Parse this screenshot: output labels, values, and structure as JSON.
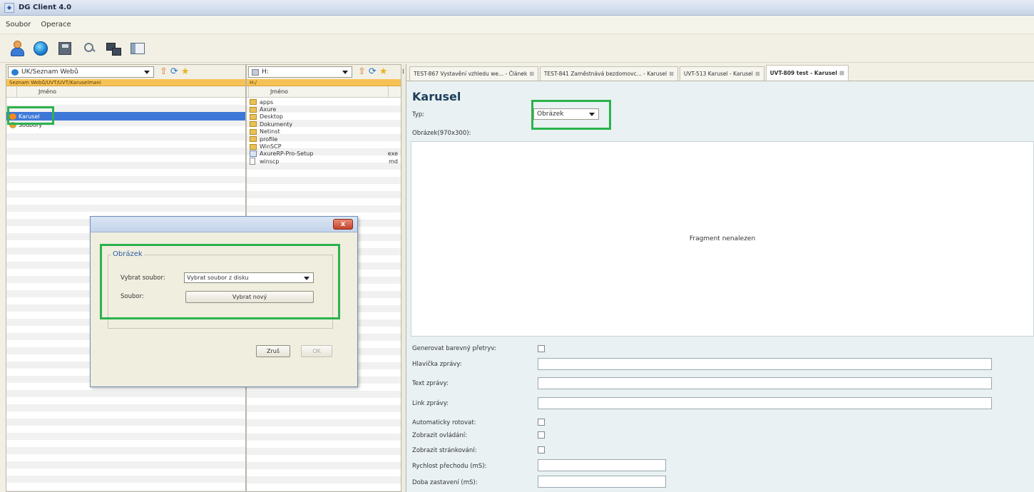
{
  "window": {
    "title": "DG Client 4.0"
  },
  "menu": {
    "items": [
      "Soubor",
      "Operace"
    ]
  },
  "toolbar": {
    "icons": [
      "user-icon",
      "globe-icon",
      "save-icon",
      "search-icon",
      "network-icon",
      "panel-icon"
    ]
  },
  "left_pane": {
    "combo_value": "UK/Seznam Webů",
    "path": "Seznam Webů/UVT/UVT/Karuselmani",
    "column_name": "Jméno",
    "tree": [
      {
        "label": "Karusel",
        "selected": true
      },
      {
        "label": "Soubory",
        "selected": false
      }
    ]
  },
  "mid_pane": {
    "combo_value": "H:",
    "path": "H:/",
    "column_name": "Jméno",
    "files": [
      {
        "name": "apps",
        "type": "folder",
        "ext": ""
      },
      {
        "name": "Axure",
        "type": "folder",
        "ext": ""
      },
      {
        "name": "Desktop",
        "type": "folder",
        "ext": ""
      },
      {
        "name": "Dokumenty",
        "type": "folder",
        "ext": ""
      },
      {
        "name": "Netinst",
        "type": "folder",
        "ext": ""
      },
      {
        "name": "profile",
        "type": "folder",
        "ext": ""
      },
      {
        "name": "WinSCP",
        "type": "folder",
        "ext": ""
      },
      {
        "name": "AxureRP-Pro-Setup",
        "type": "exe",
        "ext": "exe"
      },
      {
        "name": "winscp",
        "type": "doc",
        "ext": "md"
      }
    ]
  },
  "tabs": [
    {
      "label": "TEST-867 Vystavění vzhledu we... - Článek",
      "active": false
    },
    {
      "label": "TEST-841 Zaměstnává bezdomovc... - Karusel",
      "active": false
    },
    {
      "label": "UVT-513 Karusel - Karusel",
      "active": false
    },
    {
      "label": "UVT-809 test - Karusel",
      "active": true
    }
  ],
  "form": {
    "title": "Karusel",
    "typ_label": "Typ:",
    "typ_value": "Obrázek",
    "image_label": "Obrázek(970x300):",
    "fragment_text": "Fragment nenalezen",
    "fields": {
      "generate_label": "Generovat barevný přetryv:",
      "header_label": "Hlavička zprávy:",
      "text_label": "Text zprávy:",
      "link_label": "Link zprávy:",
      "auto_label": "Automaticky rotovat:",
      "controls_label": "Zobrazit ovládání:",
      "paging_label": "Zobrazit stránkování:",
      "speed_label": "Rychlost přechodu (mS):",
      "pause_label": "Doba zastavení (mS):"
    }
  },
  "dialog": {
    "close_symbol": "x",
    "legend": "Obrázek",
    "select_file_label": "Vybrat soubor:",
    "select_file_value": "Vybrat soubor z disku",
    "file_label": "Soubor:",
    "choose_new_label": "Vybrat nový",
    "cancel_label": "Zruš",
    "ok_label": "OK"
  },
  "colors": {
    "highlight": "#2bb24c",
    "selection": "#3d78d8",
    "pathbar": "#f7c255"
  }
}
